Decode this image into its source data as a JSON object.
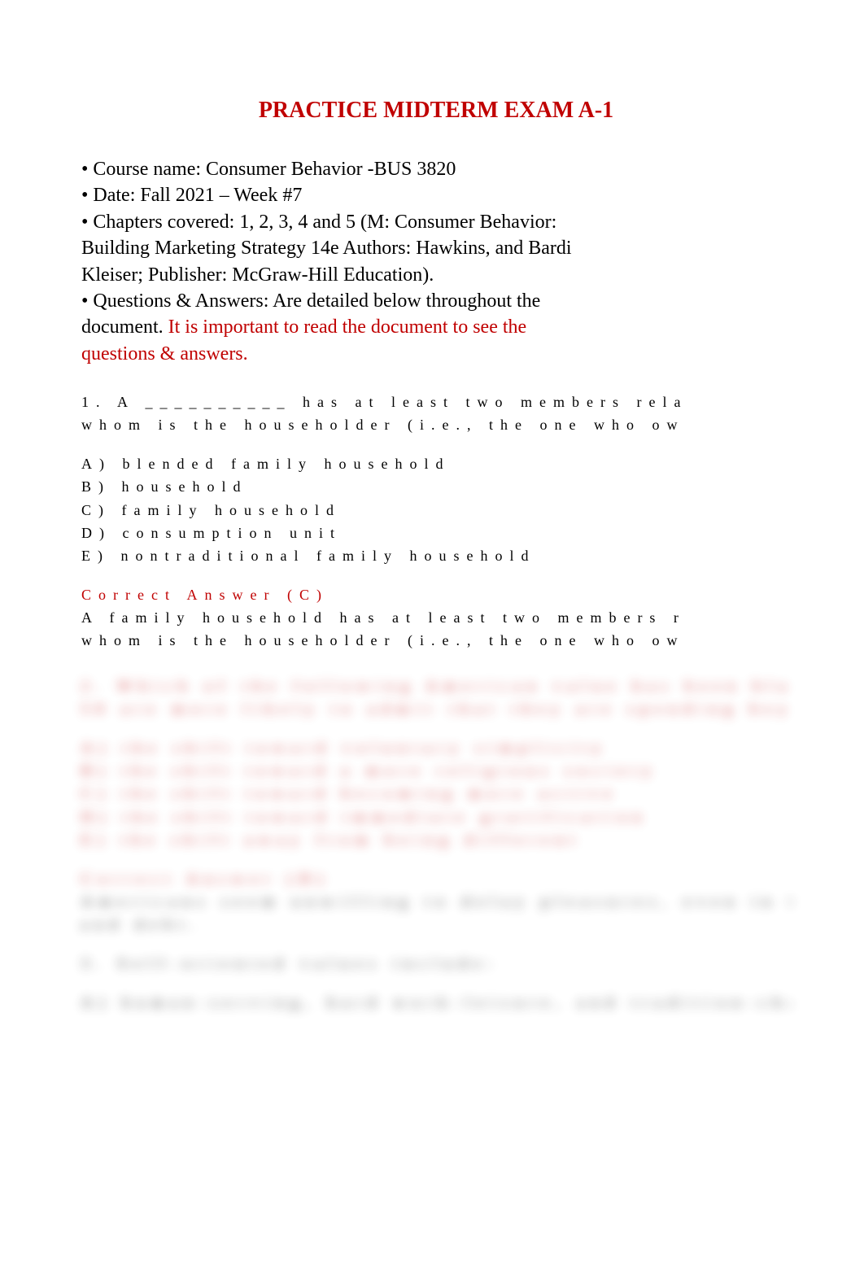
{
  "title": "PRACTICE MIDTERM EXAM A-1",
  "meta": {
    "course": "• Course name: Consumer Behavior -BUS 3820",
    "date": "• Date: Fall 2021 – Week #7",
    "chapters_l1": "• Chapters covered: 1, 2, 3, 4 and 5 (M: Consumer Behavior:",
    "chapters_l2": "Building Marketing Strategy 14e Authors: Hawkins, and Bardi",
    "chapters_l3": "Kleiser; Publisher: McGraw-Hill Education).",
    "qa_l1": "• Questions & Answers: Are detailed below throughout the",
    "qa_l2a": "document. ",
    "qa_l2b": "It is important to read the document to see the",
    "qa_l3": "questions & answers."
  },
  "q1": {
    "line1": "1.  A __________ has at least two members rela",
    "line2": "whom is the householder (i.e., the one who ow",
    "optA": "A) blended family household",
    "optB": "B) household",
    "optC": "C) family household",
    "optD": "D) consumption unit",
    "optE": "E) nontraditional family household",
    "correct": "Correct Answer (C)",
    "exp1": "A family household has at least two members r",
    "exp2": "whom is the householder (i.e., the one who ow"
  },
  "blurred": {
    "b1": "2.       Which of the following American value has been blamed for the fact that people ages 35 to",
    "b2": "50 are more likely to admit that they are spending beyond their comfort range?",
    "b3": "A)    the shift toward voluntary simplicity",
    "b4": "B)    the shift toward a more religious society",
    "b5": "C)    the shift toward becoming more active",
    "b6": "D)    the shift toward immediate gratification",
    "b7": "E)    the shift away from being different",
    "b8": "Correct Answer (D)",
    "b9": "Americans seem unwilling to delay pleasures, even in the face of this outlook over spending levels",
    "b10": "and debt.",
    "b11": "3.       Self-oriented values include:",
    "b12": "A)    human-serving, hard work-leisure, and tradition-change"
  }
}
